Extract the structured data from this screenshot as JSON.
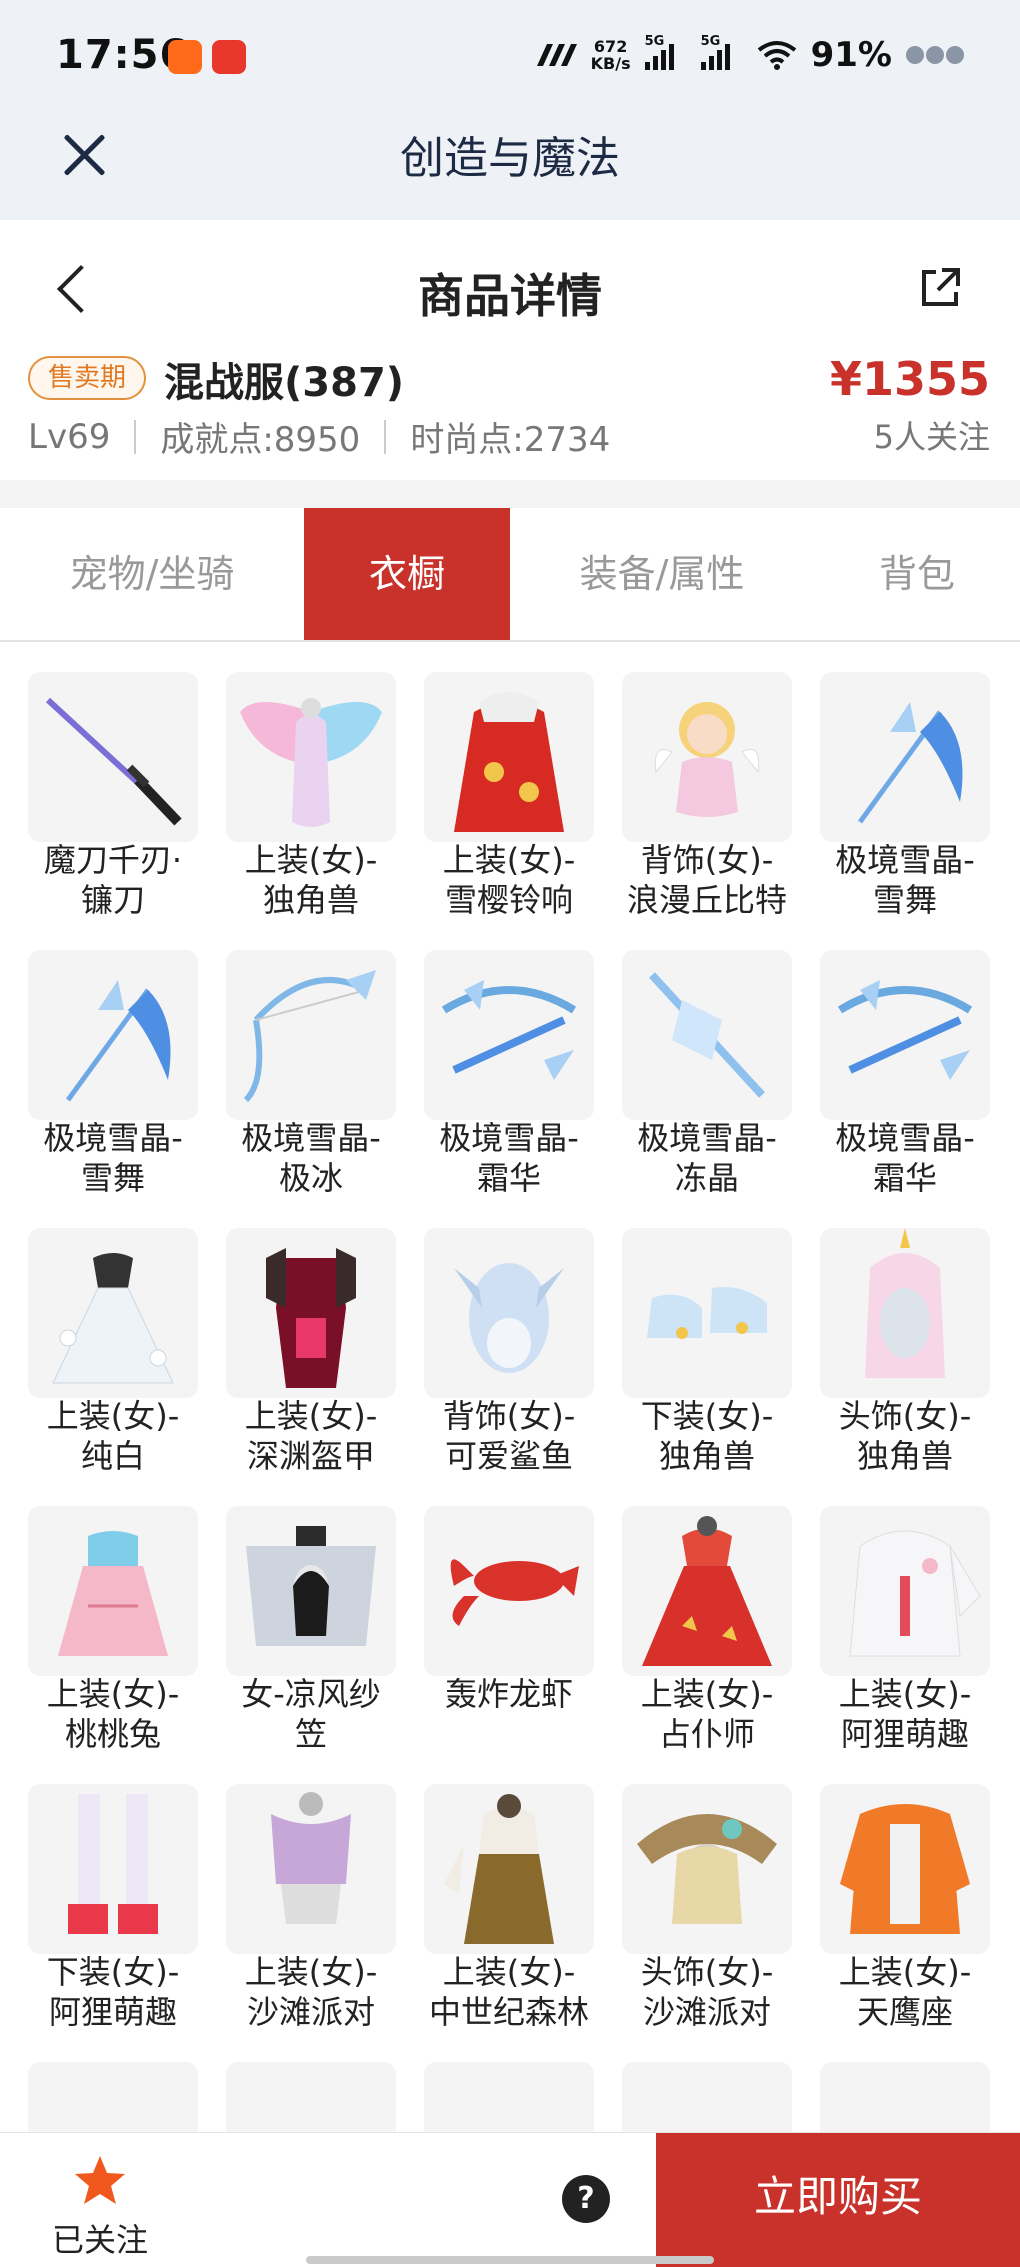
{
  "status_bar": {
    "time": "17:56",
    "net_speed_value": "672",
    "net_speed_unit": "KB/s",
    "network_a": "5G",
    "network_b": "5G",
    "battery": "91%"
  },
  "app_header": {
    "title": "创造与魔法"
  },
  "page_header": {
    "title": "商品详情"
  },
  "product": {
    "badge": "售卖期",
    "server": "混战服(387)",
    "level": "Lv69",
    "achievement": "成就点:8950",
    "fashion": "时尚点:2734",
    "price": "¥1355",
    "followers": "5人关注"
  },
  "tabs": [
    {
      "label": "宠物/坐骑",
      "active": false
    },
    {
      "label": "衣橱",
      "active": true
    },
    {
      "label": "装备/属性",
      "active": false
    },
    {
      "label": "背包",
      "active": false
    }
  ],
  "items": [
    {
      "name": "魔刀千刃·\n镰刀",
      "icon": "sword"
    },
    {
      "name": "上装(女)-\n独角兽",
      "icon": "wings"
    },
    {
      "name": "上装(女)-\n雪樱铃响",
      "icon": "dress-red"
    },
    {
      "name": "背饰(女)-\n浪漫丘比特",
      "icon": "cupid"
    },
    {
      "name": "极境雪晶-\n雪舞",
      "icon": "ice-scythe"
    },
    {
      "name": "极境雪晶-\n雪舞",
      "icon": "ice-scythe"
    },
    {
      "name": "极境雪晶-\n极冰",
      "icon": "ice-bow"
    },
    {
      "name": "极境雪晶-\n霜华",
      "icon": "ice-crossbow"
    },
    {
      "name": "极境雪晶-\n冻晶",
      "icon": "ice-spear"
    },
    {
      "name": "极境雪晶-\n霜华",
      "icon": "ice-crossbow"
    },
    {
      "name": "上装(女)-\n纯白",
      "icon": "dress-white"
    },
    {
      "name": "上装(女)-\n深渊盔甲",
      "icon": "armor-dark"
    },
    {
      "name": "背饰(女)-\n可爱鲨鱼",
      "icon": "shark"
    },
    {
      "name": "下装(女)-\n独角兽",
      "icon": "shoes"
    },
    {
      "name": "头饰(女)-\n独角兽",
      "icon": "unicorn-hood"
    },
    {
      "name": "上装(女)-\n桃桃兔",
      "icon": "dress-pink"
    },
    {
      "name": "女-凉风纱\n笠",
      "icon": "veil-hat"
    },
    {
      "name": "轰炸龙虾",
      "icon": "lobster"
    },
    {
      "name": "上装(女)-\n占仆师",
      "icon": "dress-red2"
    },
    {
      "name": "上装(女)-\n阿狸萌趣",
      "icon": "hoodie"
    },
    {
      "name": "下装(女)-\n阿狸萌趣",
      "icon": "boots"
    },
    {
      "name": "上装(女)-\n沙滩派对",
      "icon": "beach-top"
    },
    {
      "name": "上装(女)-\n中世纪森林",
      "icon": "medieval"
    },
    {
      "name": "头饰(女)-\n沙滩派对",
      "icon": "sun-hat"
    },
    {
      "name": "上装(女)-\n天鹰座",
      "icon": "jacket-orange"
    },
    {
      "name": "",
      "icon": "partial-purple"
    },
    {
      "name": "",
      "icon": "partial-red"
    },
    {
      "name": "",
      "icon": "partial-red-legs"
    },
    {
      "name": "",
      "icon": "partial-pink"
    },
    {
      "name": "",
      "icon": "partial-horns"
    }
  ],
  "bottom_bar": {
    "follow_label": "已关注",
    "help_label": "?",
    "buy_label": "立即购买"
  },
  "colors": {
    "accent": "#c8322b",
    "badge": "#e07a24",
    "header_bg": "#eef2f6"
  }
}
